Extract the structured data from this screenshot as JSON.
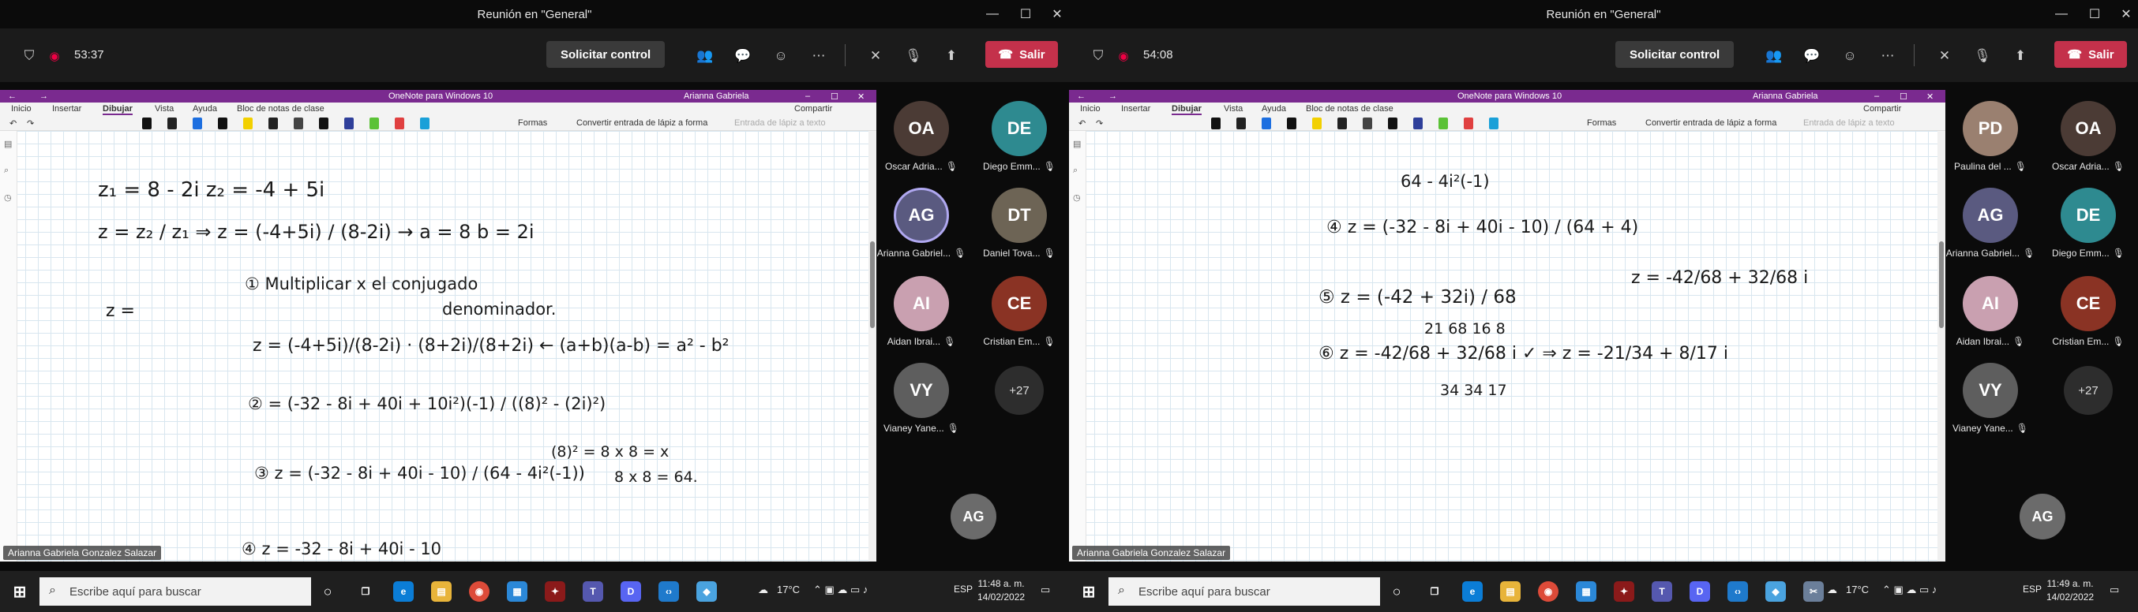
{
  "screens": [
    {
      "window_title": "Reunión en \"General\"",
      "timer": "53:37",
      "request_control": "Solicitar control",
      "leave": "Salir",
      "onenote": {
        "app_title": "OneNote para Windows 10",
        "user": "Arianna Gabriela"
      },
      "presenter": "Arianna Gabriela Gonzalez Salazar",
      "participants": [
        {
          "name": "Oscar Adria...",
          "initials": "OA",
          "color": "#4b3b35"
        },
        {
          "name": "Diego Emm...",
          "initials": "DE",
          "color": "#2e8a90"
        },
        {
          "name": "Arianna Gabriel...",
          "initials": "AG",
          "color": "#5a5a80"
        },
        {
          "name": "Daniel Tova...",
          "initials": "DT",
          "color": "#6d6455"
        },
        {
          "name": "Aidan Ibrai...",
          "initials": "AI",
          "color": "#c9a0b0"
        },
        {
          "name": "Cristian Em...",
          "initials": "CE",
          "color": "#8a3324"
        },
        {
          "name": "Vianey Yane...",
          "initials": "VY",
          "color": "#5e5e5e"
        }
      ],
      "more_count": "+27",
      "notes": [
        "z₁ = 8 - 2i      z₂ = -4 + 5i",
        "z = z₂ / z₁   ⇒   z = (-4+5i) / (8-2i)   →   a = 8    b = 2i",
        "① Multiplicar x el conjugado",
        "denominador.",
        "z =",
        "z = (-4+5i)/(8-2i) · (8+2i)/(8+2i)    ← (a+b)(a-b) = a² - b²",
        "② = (-32 - 8i + 40i + 10i²)(-1) / ((8)² - (2i)²)",
        "③ z = (-32 - 8i + 40i - 10) / (64 - 4i²(-1))",
        "(8)² = 8 x 8 = x",
        "8 x 8 = 64.",
        "④ z = -32 - 8i + 40i - 10"
      ],
      "clock": {
        "time": "11:48 a. m.",
        "date": "14/02/2022"
      }
    },
    {
      "window_title": "Reunión en \"General\"",
      "timer": "54:08",
      "request_control": "Solicitar control",
      "leave": "Salir",
      "onenote": {
        "app_title": "OneNote para Windows 10",
        "user": "Arianna Gabriela"
      },
      "presenter": "Arianna Gabriela Gonzalez Salazar",
      "participants": [
        {
          "name": "Paulina del ...",
          "initials": "PD",
          "color": "#9a8070"
        },
        {
          "name": "Oscar Adria...",
          "initials": "OA",
          "color": "#4b3b35"
        },
        {
          "name": "Arianna Gabriel...",
          "initials": "AG",
          "color": "#5a5a80"
        },
        {
          "name": "Diego Emm...",
          "initials": "DE",
          "color": "#2e8a90"
        },
        {
          "name": "Aidan Ibrai...",
          "initials": "AI",
          "color": "#c9a0b0"
        },
        {
          "name": "Cristian Em...",
          "initials": "CE",
          "color": "#8a3324"
        },
        {
          "name": "Vianey Yane...",
          "initials": "VY",
          "color": "#5e5e5e"
        }
      ],
      "more_count": "+27",
      "notes": [
        "64 - 4i²(-1)",
        "④ z = (-32 - 8i + 40i - 10) / (64 + 4)",
        "⑤ z = (-42 + 32i) / 68",
        "z = -42/68 + 32/68 i",
        "21   68   16  8",
        "⑥ z = -42/68 + 32/68 i  ✓  ⇒  z = -21/34 + 8/17 i",
        "34        34   17"
      ],
      "clock": {
        "time": "11:49 a. m.",
        "date": "14/02/2022"
      }
    }
  ],
  "menu": [
    "Inicio",
    "Insertar",
    "Dibujar",
    "Vista",
    "Ayuda",
    "Bloc de notas de clase"
  ],
  "toolbar": {
    "shapes": "Formas",
    "convert": "Convertir entrada de lápiz a forma",
    "ink_text": "Entrada de lápiz a texto",
    "share": "Compartir"
  },
  "taskbar": {
    "search_placeholder": "Escribe aquí para buscar",
    "temperature": "17°C",
    "lang": "ESP"
  },
  "colors": {
    "teams_dark": "#0b0b0b",
    "leave_red": "#c4314b",
    "onenote_purple": "#7a2a8f"
  }
}
